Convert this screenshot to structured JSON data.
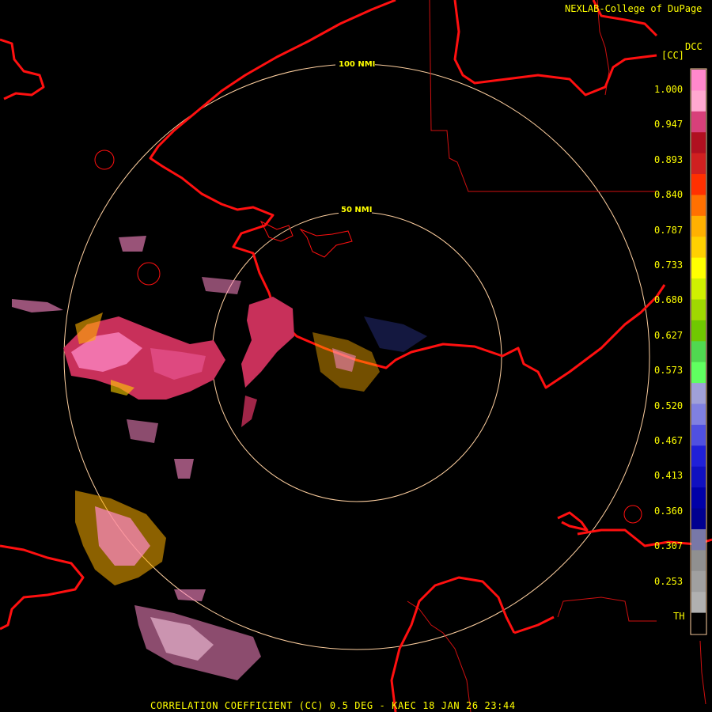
{
  "credit": "NEXLAB-College of DuPage",
  "product_code": "DCC",
  "unit": "[CC]",
  "colorbar": {
    "ticks": [
      "1.000",
      "0.947",
      "0.893",
      "0.840",
      "0.787",
      "0.733",
      "0.680",
      "0.627",
      "0.573",
      "0.520",
      "0.467",
      "0.413",
      "0.360",
      "0.307",
      "0.253",
      "TH"
    ],
    "colors": [
      "#ff88cc",
      "#ffa8d0",
      "#d8407a",
      "#b01020",
      "#d02020",
      "#ff3000",
      "#ff7000",
      "#ffb000",
      "#ffd000",
      "#ffff00",
      "#d0f000",
      "#a0d800",
      "#70c800",
      "#50d850",
      "#60ff60",
      "#a0a0d8",
      "#8080e0",
      "#5050e0",
      "#2020d8",
      "#1010c0",
      "#0000a8",
      "#000090",
      "#7878a8",
      "#909090",
      "#a0a0a0",
      "#b0b0b0",
      "#000000"
    ]
  },
  "rings": [
    {
      "label": "100 NMI"
    },
    {
      "label": "50 NMI"
    }
  ],
  "footer": "CORRELATION COEFFICIENT (CC) 0.5 DEG - KAEC 18 JAN 26 23:44",
  "colors": {
    "coast": "#ff1010",
    "border": "#e01010",
    "ring": "#ffd0a0",
    "text": "#ffff00"
  }
}
